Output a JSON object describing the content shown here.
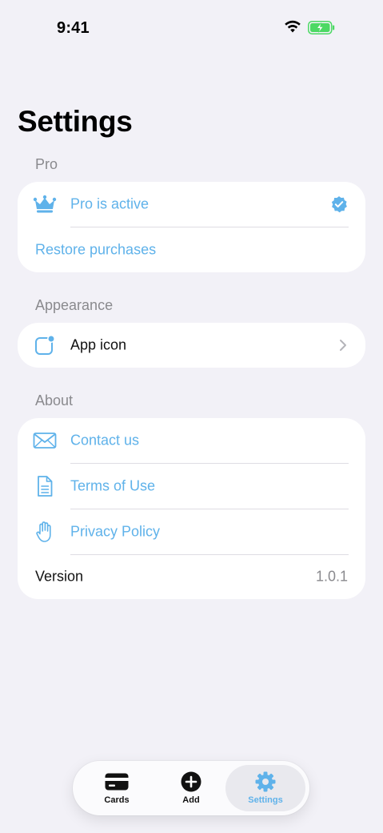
{
  "status_bar": {
    "time": "9:41"
  },
  "page": {
    "title": "Settings"
  },
  "sections": {
    "pro": {
      "header": "Pro",
      "rows": [
        {
          "label": "Pro is active",
          "icon": "crown-icon",
          "trailing": "verified-check-icon"
        },
        {
          "label": "Restore purchases"
        }
      ]
    },
    "appearance": {
      "header": "Appearance",
      "rows": [
        {
          "label": "App icon",
          "icon": "app-icon-badge-icon",
          "trailing": "chevron-right-icon"
        }
      ]
    },
    "about": {
      "header": "About",
      "rows": [
        {
          "label": "Contact us",
          "icon": "envelope-icon"
        },
        {
          "label": "Terms of Use",
          "icon": "document-icon"
        },
        {
          "label": "Privacy Policy",
          "icon": "hand-raised-icon"
        },
        {
          "label": "Version",
          "value": "1.0.1"
        }
      ]
    }
  },
  "tab_bar": {
    "tabs": [
      {
        "label": "Cards",
        "icon": "card-icon",
        "active": false
      },
      {
        "label": "Add",
        "icon": "plus-circle-icon",
        "active": false
      },
      {
        "label": "Settings",
        "icon": "gear-icon",
        "active": true
      }
    ]
  },
  "colors": {
    "accent": "#5fb2ea",
    "background": "#f2f1f7",
    "secondary_text": "#8a8a8e",
    "battery_green": "#4cd964"
  }
}
